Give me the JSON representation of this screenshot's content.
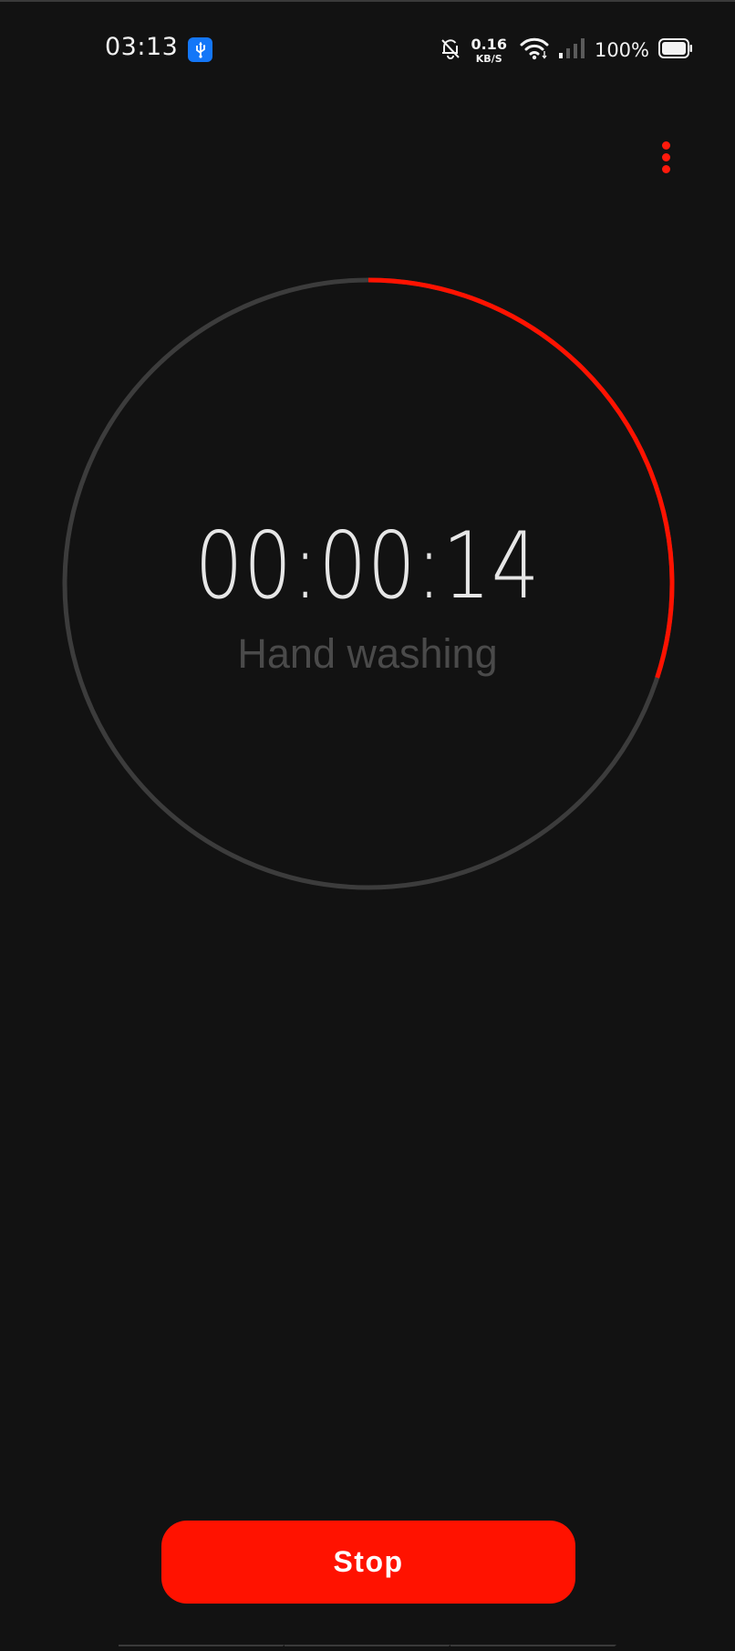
{
  "status_bar": {
    "time": "03:13",
    "usb_icon": "usb-icon",
    "dnd_icon": "bell-off-icon",
    "net_speed_value": "0.16",
    "net_speed_unit": "KB/S",
    "wifi_icon": "wifi-icon",
    "signal_icon": "cell-signal-icon",
    "battery_percent": "100%",
    "battery_icon": "battery-icon"
  },
  "toolbar": {
    "overflow_icon": "more-vertical-icon"
  },
  "timer": {
    "time": "00:00:14",
    "label": "Hand washing",
    "progress": 0.3
  },
  "actions": {
    "stop_label": "Stop"
  },
  "colors": {
    "background": "#121212",
    "accent": "#ff1200",
    "ring_track": "#3c3c3c",
    "label": "#4a4a4a"
  }
}
